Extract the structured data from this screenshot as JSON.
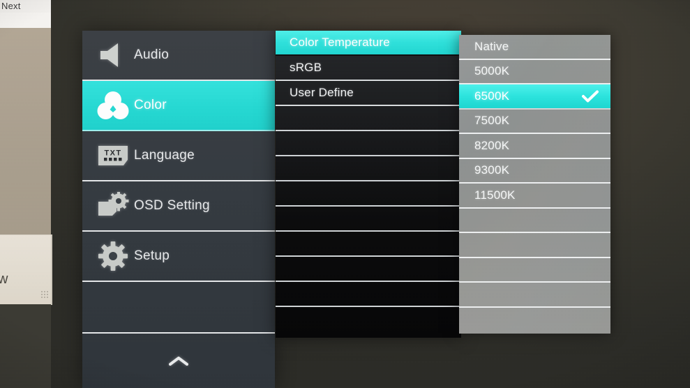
{
  "background": {
    "window_top_label": "Next",
    "window_bottom_label": "w"
  },
  "osd": {
    "accent_color": "#2ADFD9",
    "panel_dark_color": "#343a40",
    "panel_black_color": "#0a0a0b",
    "panel_grey_color": "#8c8e8c",
    "separator_color": "#e6e8ea"
  },
  "sidebar": {
    "items": [
      {
        "label": "Audio",
        "icon": "speaker-icon",
        "selected": false
      },
      {
        "label": "Color",
        "icon": "color-wheel-icon",
        "selected": true
      },
      {
        "label": "Language",
        "icon": "txt-badge-icon",
        "selected": false
      },
      {
        "label": "OSD Setting",
        "icon": "osd-gear-icon",
        "selected": false
      },
      {
        "label": "Setup",
        "icon": "gear-icon",
        "selected": false
      }
    ],
    "footer_icon": "chevron-up-icon"
  },
  "submenu": {
    "items": [
      {
        "label": "Color Temperature",
        "selected": true
      },
      {
        "label": "sRGB",
        "selected": false
      },
      {
        "label": "User Define",
        "selected": false
      }
    ],
    "blank_row_count": 9
  },
  "options": {
    "items": [
      {
        "label": "Native",
        "selected": false,
        "checked": false
      },
      {
        "label": "5000K",
        "selected": false,
        "checked": false
      },
      {
        "label": "6500K",
        "selected": true,
        "checked": true
      },
      {
        "label": "7500K",
        "selected": false,
        "checked": false
      },
      {
        "label": "8200K",
        "selected": false,
        "checked": false
      },
      {
        "label": "9300K",
        "selected": false,
        "checked": false
      },
      {
        "label": "11500K",
        "selected": false,
        "checked": false
      }
    ],
    "blank_row_count": 5,
    "check_icon": "check-icon"
  }
}
